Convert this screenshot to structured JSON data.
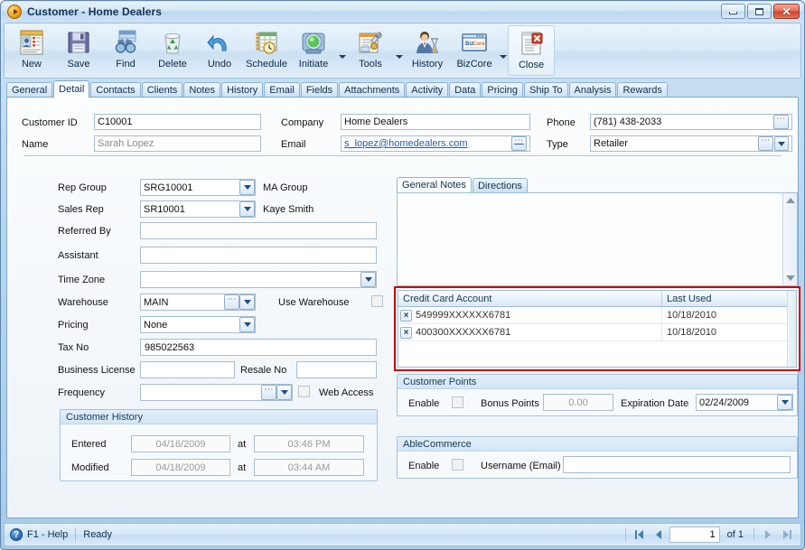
{
  "window": {
    "title": "Customer - Home Dealers",
    "icon": "app-orb-icon",
    "buttons": {
      "minimize": "minimize",
      "maximize": "maximize",
      "close": "close"
    }
  },
  "toolbar": {
    "items": [
      {
        "label": "New",
        "icon": "new-contact-icon",
        "dropdown": false,
        "selected": false
      },
      {
        "label": "Save",
        "icon": "floppy-disk-icon",
        "dropdown": false,
        "selected": false
      },
      {
        "label": "Find",
        "icon": "binoculars-icon",
        "dropdown": false,
        "selected": false
      },
      {
        "label": "Delete",
        "icon": "recycle-bin-icon",
        "dropdown": false,
        "selected": false
      },
      {
        "label": "Undo",
        "icon": "undo-arrow-icon",
        "dropdown": false,
        "selected": false
      },
      {
        "label": "Schedule",
        "icon": "calendar-clock-icon",
        "dropdown": false,
        "selected": false
      },
      {
        "label": "Initiate",
        "icon": "green-light-icon",
        "dropdown": true,
        "selected": false
      },
      {
        "label": "Tools",
        "icon": "wrench-tools-icon",
        "dropdown": true,
        "selected": false
      },
      {
        "label": "History",
        "icon": "person-hourglass-icon",
        "dropdown": false,
        "selected": false
      },
      {
        "label": "BizCore",
        "icon": "bizcore-window-icon",
        "dropdown": true,
        "selected": false
      },
      {
        "label": "Close",
        "icon": "close-document-icon",
        "dropdown": false,
        "selected": true
      }
    ]
  },
  "tabs": [
    {
      "label": "General",
      "active": false
    },
    {
      "label": "Detail",
      "active": true
    },
    {
      "label": "Contacts",
      "active": false
    },
    {
      "label": "Clients",
      "active": false
    },
    {
      "label": "Notes",
      "active": false
    },
    {
      "label": "History",
      "active": false
    },
    {
      "label": "Email",
      "active": false
    },
    {
      "label": "Fields",
      "active": false
    },
    {
      "label": "Attachments",
      "active": false
    },
    {
      "label": "Activity",
      "active": false
    },
    {
      "label": "Data",
      "active": false
    },
    {
      "label": "Pricing",
      "active": false
    },
    {
      "label": "Ship To",
      "active": false
    },
    {
      "label": "Analysis",
      "active": false
    },
    {
      "label": "Rewards",
      "active": false
    }
  ],
  "header": {
    "customer_id_label": "Customer ID",
    "customer_id_value": "C10001",
    "name_label": "Name",
    "name_value": "Sarah Lopez",
    "company_label": "Company",
    "company_value": "Home Dealers",
    "email_label": "Email",
    "email_value": "s_lopez@homedealers.com",
    "phone_label": "Phone",
    "phone_value": "(781) 438-2033",
    "type_label": "Type",
    "type_value": "Retailer"
  },
  "detail": {
    "rep_group_label": "Rep Group",
    "rep_group_value": "SRG10001",
    "ma_group_label": "MA Group",
    "sales_rep_label": "Sales Rep",
    "sales_rep_value": "SR10001",
    "sales_rep_name": "Kaye Smith",
    "referred_by_label": "Referred By",
    "referred_by_value": "",
    "assistant_label": "Assistant",
    "assistant_value": "",
    "time_zone_label": "Time Zone",
    "time_zone_value": "",
    "warehouse_label": "Warehouse",
    "warehouse_value": "MAIN",
    "use_warehouse_label": "Use Warehouse",
    "use_warehouse_checked": false,
    "pricing_label": "Pricing",
    "pricing_value": "None",
    "tax_no_label": "Tax No",
    "tax_no_value": "985022563",
    "business_license_label": "Business License",
    "business_license_value": "",
    "resale_no_label": "Resale No",
    "resale_no_value": "",
    "frequency_label": "Frequency",
    "frequency_value": "",
    "web_access_label": "Web Access",
    "web_access_checked": false
  },
  "customer_history": {
    "caption": "Customer History",
    "entered_label": "Entered",
    "entered_date": "04/16/2009",
    "entered_at_label": "at",
    "entered_time": "03:46 PM",
    "modified_label": "Modified",
    "modified_date": "04/18/2009",
    "modified_at_label": "at",
    "modified_time": "03:44 AM"
  },
  "notes": {
    "tabs": [
      {
        "label": "General Notes",
        "active": true
      },
      {
        "label": "Directions",
        "active": false
      }
    ],
    "content": ""
  },
  "credit_cards": {
    "highlight_color": "#cc0000",
    "columns": [
      "Credit Card Account",
      "Last Used"
    ],
    "rows": [
      {
        "delete": "×",
        "account": "549999XXXXXX6781",
        "last_used": "10/18/2010"
      },
      {
        "delete": "×",
        "account": "400300XXXXXX6781",
        "last_used": "10/18/2010"
      }
    ]
  },
  "customer_points": {
    "caption": "Customer Points",
    "enable_label": "Enable",
    "enable_checked": false,
    "bonus_points_label": "Bonus Points",
    "bonus_points_value": "0.00",
    "expiration_date_label": "Expiration Date",
    "expiration_date_value": "02/24/2009"
  },
  "able_commerce": {
    "caption": "AbleCommerce",
    "enable_label": "Enable",
    "enable_checked": false,
    "username_label": "Username (Email)",
    "username_value": ""
  },
  "statusbar": {
    "help_icon": "help-question-icon",
    "help_label": "F1 - Help",
    "status_label": "Ready",
    "nav": {
      "first": "first-record",
      "prev": "previous-record",
      "page_value": "1",
      "of_label": "of 1",
      "next": "next-record",
      "last": "last-record"
    }
  }
}
